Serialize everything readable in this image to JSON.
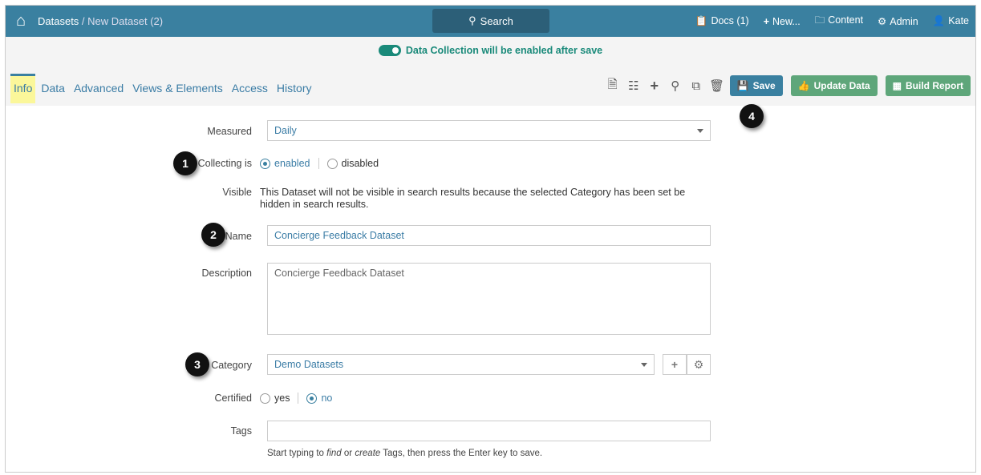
{
  "header": {
    "breadcrumb_root": "Datasets",
    "breadcrumb_sep": " / ",
    "breadcrumb_current": "New Dataset (2)",
    "search_label": "Search",
    "nav": [
      {
        "label": "Docs (1)",
        "icon": "clipboard-icon"
      },
      {
        "label": "New...",
        "icon": "plus-icon"
      },
      {
        "label": "Content",
        "icon": "folder-icon"
      },
      {
        "label": "Admin",
        "icon": "gear-icon"
      },
      {
        "label": "Kate",
        "icon": "user-icon"
      }
    ]
  },
  "banner": "Data Collection will be enabled after save",
  "tabs": [
    "Info",
    "Data",
    "Advanced",
    "Views & Elements",
    "Access",
    "History"
  ],
  "toolbar": {
    "save": "Save",
    "update": "Update Data",
    "build": "Build Report"
  },
  "form": {
    "measured_label": "Measured",
    "measured_value": "Daily",
    "collecting_label": "Collecting is",
    "enabled": "enabled",
    "disabled": "disabled",
    "visible_label": "Visible",
    "visible_text": "This Dataset will not be visible in search results because the selected Category has been set be hidden in search results.",
    "name_label": "Name",
    "name_value": "Concierge Feedback Dataset",
    "description_label": "Description",
    "description_value": "Concierge Feedback Dataset",
    "category_label": "Category",
    "category_value": "Demo Datasets",
    "certified_label": "Certified",
    "yes": "yes",
    "no": "no",
    "tags_label": "Tags",
    "tags_value": "",
    "tags_hint_1": "Start typing to ",
    "tags_hint_find": "find",
    "tags_hint_2": " or ",
    "tags_hint_create": "create",
    "tags_hint_3": " Tags, then press the Enter key to save."
  },
  "badges": [
    "1",
    "2",
    "3",
    "4"
  ]
}
